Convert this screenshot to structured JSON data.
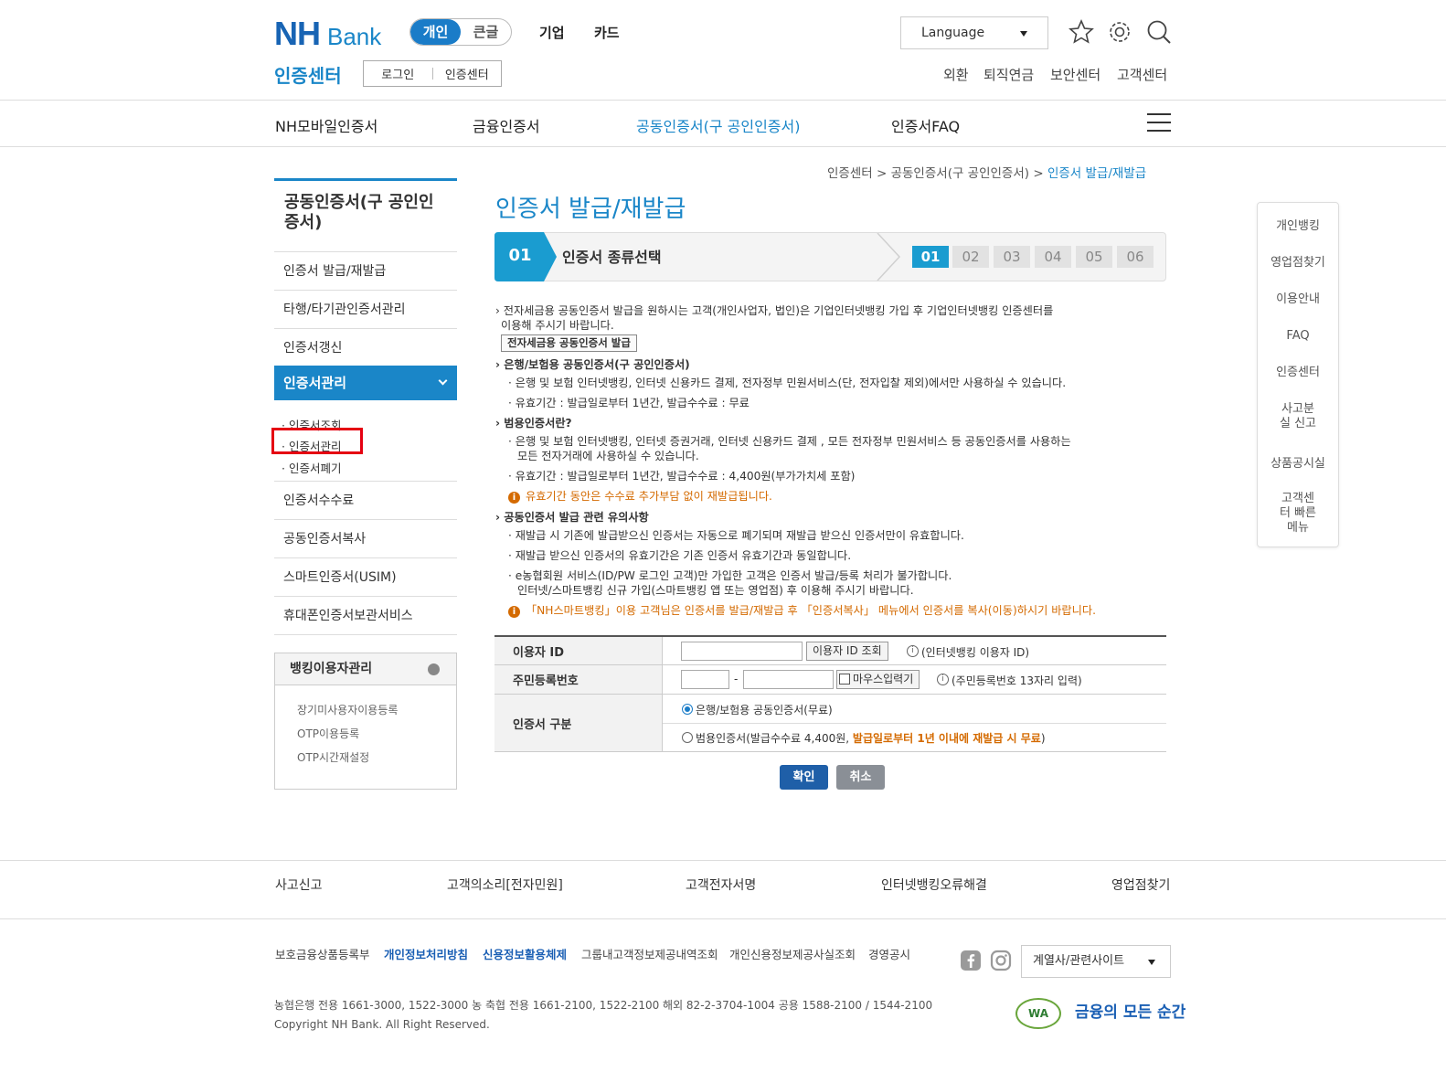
{
  "header": {
    "logo_main": "NH",
    "logo_sub": "Bank",
    "toggle": {
      "active": "개인",
      "inactive": "큰글"
    },
    "top_links": [
      "기업",
      "카드"
    ],
    "language": "Language",
    "section_title": "인증센터",
    "subnav": [
      "로그인",
      "인증센터"
    ],
    "util_links": [
      "외환",
      "퇴직연금",
      "보안센터",
      "고객센터"
    ]
  },
  "gnb": {
    "items": [
      "NH모바일인증서",
      "금융인증서",
      "공동인증서(구 공인인증서)",
      "인증서FAQ"
    ],
    "active_index": 2
  },
  "sidebar": {
    "title": "공동인증서(구 공인인증서)",
    "items_top": [
      "인증서 발급/재발급",
      "타행/타기관인증서관리",
      "인증서갱신"
    ],
    "active": "인증서관리",
    "sub_items": [
      "· 인증서조회",
      "· 인증서관리",
      "· 인증서폐기"
    ],
    "items_bottom": [
      "인증서수수료",
      "공동인증서복사",
      "스마트인증서(USIM)",
      "휴대폰인증서보관서비스"
    ],
    "banking": {
      "title": "뱅킹이용자관리",
      "links": [
        "장기미사용자이용등록",
        "OTP이용등록",
        "OTP시간재설정"
      ]
    }
  },
  "main": {
    "breadcrumb": [
      "인증센터",
      "공동인증서(구 공인인증서)",
      "인증서 발급/재발급"
    ],
    "title": "인증서 발급/재발급",
    "step": {
      "num": "01",
      "label": "인증서 종류선택",
      "steps": [
        "01",
        "02",
        "03",
        "04",
        "05",
        "06"
      ],
      "current": 0
    },
    "notice1_line1": "전자세금용 공동인증서 발급을 원하시는 고객(개인사업자, 법인)은 기업인터넷뱅킹 가입 후 기업인터넷뱅킹 인증센터를",
    "notice1_line2": "이용해 주시기 바랍니다.",
    "etax_button": "전자세금용 공동인증서 발급",
    "sec1_title": "은행/보험용 공동인증서(구 공인인증서)",
    "sec1_b1": "· 은행 및 보험 인터넷뱅킹, 인터넷 신용카드 결제, 전자정부 민원서비스(단, 전자입찰 제외)에서만 사용하실 수 있습니다.",
    "sec1_b2": "· 유효기간 : 발급일로부터 1년간, 발급수수료 : 무료",
    "sec2_title": "범용인증서란?",
    "sec2_b1_l1": "· 은행 및 보험 인터넷뱅킹, 인터넷 증권거래, 인터넷 신용카드 결제 , 모든 전자정부 민원서비스 등 공동인증서를 사용하는",
    "sec2_b1_l2": "모든 전자거래에 사용하실 수 있습니다.",
    "sec2_b2": "· 유효기간 : 발급일로부터 1년간, 발급수수료 : 4,400원(부가가치세 포함)",
    "sec2_warn": "유효기간 동안은 수수료 추가부담 없이 재발급됩니다.",
    "sec3_title": "공동인증서 발급 관련 유의사항",
    "sec3_b1": "· 재발급 시 기존에 발급받으신 인증서는 자동으로 폐기되며 재발급 받으신 인증서만이 유효합니다.",
    "sec3_b2": "· 재발급 받으신 인증서의 유효기간은 기존 인증서 유효기간과 동일합니다.",
    "sec3_b3_l1": "· e농협회원 서비스(ID/PW 로그인 고객)만 가입한 고객은 인증서 발급/등록 처리가 불가합니다.",
    "sec3_b3_l2": "인터넷/스마트뱅킹 신규 가입(스마트뱅킹 앱 또는 영업점) 후 이용해 주시기 바랍니다.",
    "sec3_warn": "「NH스마트뱅킹」이용 고객님은 인증서를 발급/재발급 후 「인증서복사」 메뉴에서 인증서를 복사(이동)하시기 바랍니다.",
    "form": {
      "id_label": "이용자 ID",
      "id_value": "",
      "id_lookup": "이용자 ID 조회",
      "id_hint": "(인터넷뱅킹 이용자 ID)",
      "rrn_label": "주민등록번호",
      "rrn_front": "",
      "rrn_back": "",
      "rrn_dash": "-",
      "mouse_input": "마우스입력기",
      "rrn_hint": "(주민등록번호 13자리 입력)",
      "type_label": "인증서 구분",
      "opt1": "은행/보험용 공동인증서(무료)",
      "opt2_prefix": "범용인증서(발급수수료 4,400원, ",
      "opt2_highlight": "발급일로부터 1년 이내에 재발급 시 무료",
      "opt2_suffix": ")",
      "selected": "opt1"
    },
    "confirm": "확인",
    "cancel": "취소"
  },
  "quick_menu": [
    "개인뱅킹",
    "영업점찾기",
    "이용안내",
    "FAQ",
    "인증센터",
    "사고분실 신고",
    "상품공시실",
    "고객센터 빠른메뉴"
  ],
  "footer": {
    "links1": [
      "사고신고",
      "고객의소리[전자민원]",
      "고객전자서명",
      "인터넷뱅킹오류해결",
      "영업점찾기"
    ],
    "links2": [
      "보호금융상품등록부",
      "개인정보처리방침",
      "신용정보활용체제",
      "그룹내고객정보제공내역조회",
      "개인신용정보제공사실조회",
      "경영공시"
    ],
    "family_site": "계열사/관련사이트",
    "phones": "농협은행 전용 1661-3000, 1522-3000    농 축협 전용 1661-2100, 1522-2100    해외 82-2-3704-1004    공용 1588-2100 / 1544-2100",
    "copyright": "Copyright NH Bank. All Right Reserved.",
    "wa_mark": "WA",
    "slogan": "금융의 모든 순간"
  },
  "colors": {
    "brand": "#1a86c8",
    "brand_dark": "#1864b4",
    "warning": "#d46a00",
    "highlight_box": "#e50012"
  }
}
